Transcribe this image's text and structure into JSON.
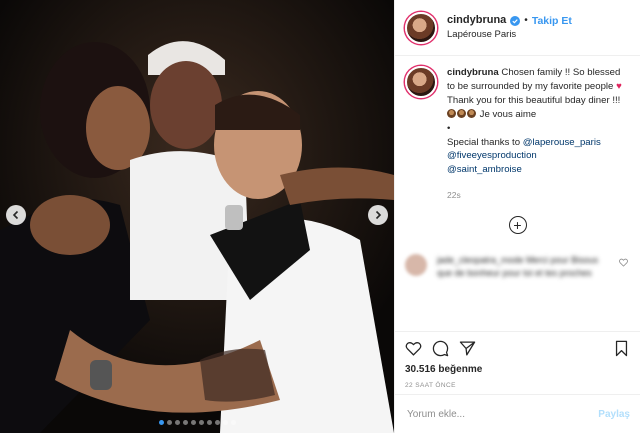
{
  "post": {
    "username": "cindybruna",
    "follow_label": "Takip Et",
    "location": "Lapérouse Paris",
    "caption": {
      "line1": "Chosen family !! So blessed to be surrounded by my favorite people",
      "line2": "Thank you for this beautiful bday diner !!!",
      "line3": "Je vous aime",
      "line4": "•",
      "line5": "Special thanks to",
      "mention1": "@laperouse_paris",
      "mention2": "@fiveeyesproduction",
      "mention3": "@saint_ambroise"
    },
    "caption_time": "22s",
    "likes": "30.516 beğenme",
    "posted": "22 SAAT ÖNCE"
  },
  "comment": {
    "text": "jade_cleopatra_mode Merci pour Bisous que de bonheur pour toi et tes proches"
  },
  "comment_bar": {
    "placeholder": "Yorum ekle...",
    "share_label": "Paylaş"
  },
  "carousel": {
    "total": 10,
    "active_index": 0
  },
  "colors": {
    "accent": "#3897f0",
    "like_red": "#e0245e",
    "mention": "#00376b"
  },
  "icons": [
    "verified-badge-icon",
    "chevron-left-icon",
    "chevron-right-icon",
    "heart-icon",
    "comment-icon",
    "share-icon",
    "bookmark-icon",
    "plus-circle-icon"
  ]
}
